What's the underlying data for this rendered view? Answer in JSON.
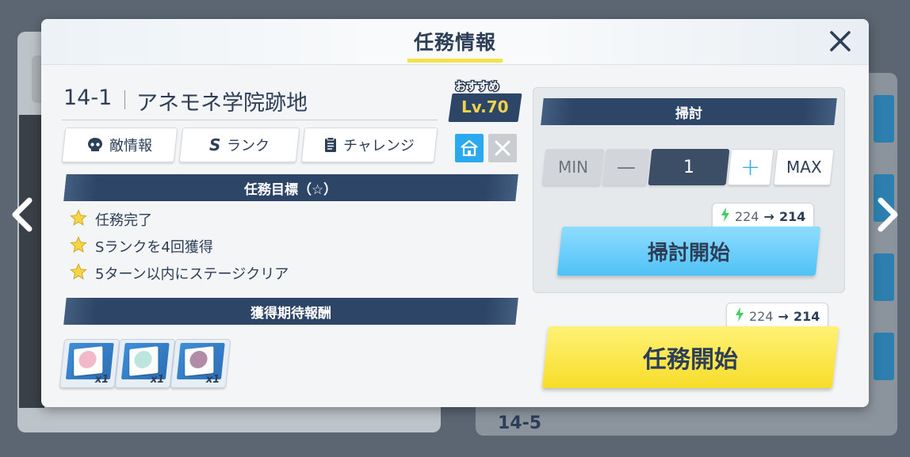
{
  "dialog": {
    "title": "任務情報",
    "stage_id": "14-1",
    "stage_name": "アネモネ学院跡地",
    "recommended_label": "おすすめ",
    "recommended_level": "Lv.70"
  },
  "tabs": [
    {
      "label": "敵情報",
      "icon": "skull-icon"
    },
    {
      "label": "ランク",
      "icon": "S"
    },
    {
      "label": "チャレンジ",
      "icon": "clipboard-icon"
    }
  ],
  "objectives": {
    "header": "任務目標（☆）",
    "items": [
      "任務完了",
      "Sランクを4回獲得",
      "5ターン以内にステージクリア"
    ]
  },
  "rewards": {
    "header": "獲得期待報酬",
    "items": [
      {
        "qty": "x1",
        "color": "#f2b9c9"
      },
      {
        "qty": "x1",
        "color": "#bde5e0"
      },
      {
        "qty": "x1",
        "color": "#b28ba6"
      }
    ]
  },
  "sweep": {
    "header": "掃討",
    "min_label": "MIN",
    "minus_label": "—",
    "count": "1",
    "plus_label": "+",
    "max_label": "MAX",
    "ap_from": "224",
    "ap_arrow": "→",
    "ap_to": "214",
    "start_label": "掃討開始"
  },
  "mission": {
    "ap_from": "224",
    "ap_arrow": "→",
    "ap_to": "214",
    "start_label": "任務開始"
  },
  "background": {
    "stage_label": "14-5"
  },
  "colors": {
    "navy": "#2d3e58",
    "sweep_blue": "#4fc2f5",
    "mission_yellow": "#f7dd2a",
    "home_blue": "#2aa9ef",
    "ap_green": "#3fcf5e"
  }
}
